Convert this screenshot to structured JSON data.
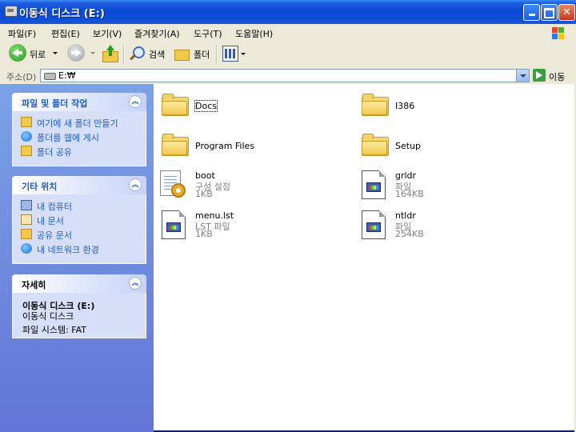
{
  "window": {
    "title": "이동식 디스크 (E:)"
  },
  "menubar": {
    "items": [
      "파일(F)",
      "편집(E)",
      "보기(V)",
      "즐겨찾기(A)",
      "도구(T)",
      "도움말(H)"
    ]
  },
  "toolbar": {
    "back_label": "뒤로",
    "search_label": "검색",
    "folders_label": "폴더"
  },
  "address": {
    "label": "주소(D)",
    "value": "E:₩",
    "go_label": "이동"
  },
  "tasks_panel": {
    "title": "파일 및 폴더 작업",
    "items": [
      "여기에 새 폴더 만들기",
      "폴더를 웹에 게시",
      "폴더 공유"
    ]
  },
  "places_panel": {
    "title": "기타 위치",
    "items": [
      "내 컴퓨터",
      "내 문서",
      "공유 문서",
      "내 네트워크 환경"
    ]
  },
  "details_panel": {
    "title": "자세히",
    "name": "이동식 디스크 (E:)",
    "type": "이동식 디스크",
    "filesystem": "파일 시스템: FAT"
  },
  "files": [
    {
      "name": "Docs",
      "kind": "folder"
    },
    {
      "name": "I386",
      "kind": "folder"
    },
    {
      "name": "Program Files",
      "kind": "folder"
    },
    {
      "name": "Setup",
      "kind": "folder"
    },
    {
      "name": "boot",
      "type": "구성 설정",
      "size": "1KB",
      "kind": "config"
    },
    {
      "name": "grldr",
      "type": "파일",
      "size": "164KB",
      "kind": "file"
    },
    {
      "name": "menu.lst",
      "type": "LST 파일",
      "size": "1KB",
      "kind": "file"
    },
    {
      "name": "ntldr",
      "type": "파일",
      "size": "254KB",
      "kind": "file"
    }
  ],
  "colors": {
    "title_bar": "#0a49d4",
    "task_link": "#215dc6",
    "left_pane": "#6f8fe0",
    "chrome": "#ece9d8"
  }
}
